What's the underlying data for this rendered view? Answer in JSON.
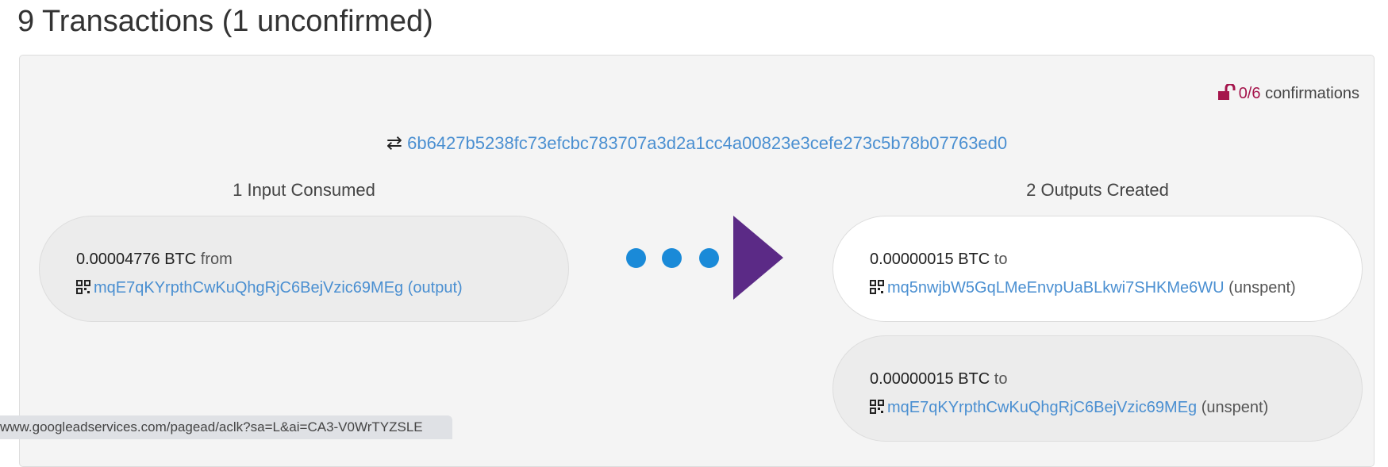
{
  "page_title": "9 Transactions (1 unconfirmed)",
  "transaction": {
    "confirmations_count": "0/6",
    "confirmations_label": "confirmations",
    "txid": "6b6427b5238fc73efcbc783707a3d2a1cc4a00823e3cefe273c5b78b07763ed0",
    "inputs_header": "1 Input Consumed",
    "outputs_header": "2 Outputs Created",
    "inputs": [
      {
        "amount": "0.00004776 BTC",
        "direction": "from",
        "address": "mqE7qKYrpthCwKuQhgRjC6BejVzic69MEg",
        "note": "(output)"
      }
    ],
    "outputs": [
      {
        "amount": "0.00000015 BTC",
        "direction": "to",
        "address": "mq5nwjbW5GqLMeEnvpUaBLkwi7SHKMe6WU",
        "note": "(unspent)"
      },
      {
        "amount": "0.00000015 BTC",
        "direction": "to",
        "address": "mqE7qKYrpthCwKuQhgRjC6BejVzic69MEg",
        "note": "(unspent)"
      }
    ]
  },
  "status_bar": {
    "url": "www.googleadservices.com/pagead/aclk?sa=L&ai=CA3-V0WrTYZSLE"
  },
  "colors": {
    "link": "#4a8fd1",
    "unconfirmed": "#a5154c",
    "dots": "#1a8ad8",
    "arrow": "#5b2a86"
  }
}
